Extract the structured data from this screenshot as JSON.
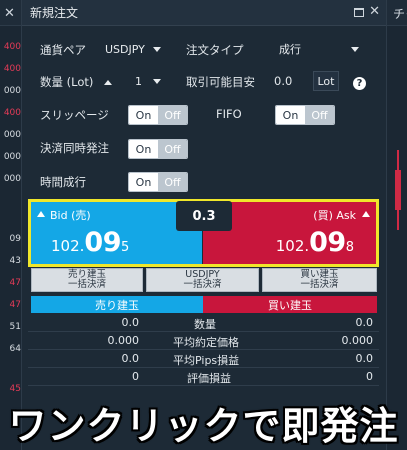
{
  "window": {
    "title": "新規注文"
  },
  "right_panel": {
    "title": "チャ"
  },
  "left_values": [
    "400",
    "400",
    "000",
    "400",
    "000",
    "000",
    "000",
    "09",
    "43",
    "47",
    "47",
    "51",
    "64",
    "45"
  ],
  "form": {
    "currency_pair_label": "通貨ペア",
    "currency_pair_value": "USDJPY",
    "order_type_label": "注文タイプ",
    "order_type_value": "成行",
    "quantity_label": "数量 (Lot)",
    "quantity_value": "1",
    "tradable_label": "取引可能目安",
    "tradable_value": "0.0",
    "tradable_unit": "Lot",
    "help_symbol": "?",
    "slippage_label": "スリッページ",
    "fifo_label": "FIFO",
    "settle_label": "決済同時発注",
    "time_label": "時間成行",
    "on": "On",
    "off": "Off"
  },
  "prices": {
    "bid_label": "Bid (売)",
    "ask_label": "(買) Ask",
    "bid_prefix": "102.",
    "bid_big": "09",
    "bid_suffix": "5",
    "ask_prefix": "102.",
    "ask_big": "09",
    "ask_suffix": "8",
    "spread": "0.3"
  },
  "actions": [
    {
      "line1": "売り建玉",
      "line2": "一括決済"
    },
    {
      "line1": "USDJPY",
      "line2": "一括決済"
    },
    {
      "line1": "買い建玉",
      "line2": "一括決済"
    }
  ],
  "positions": {
    "sell_header": "売り建玉",
    "buy_header": "買い建玉",
    "rows": [
      {
        "label": "数量",
        "sell": "0.0",
        "buy": "0.0"
      },
      {
        "label": "平均約定価格",
        "sell": "0.000",
        "buy": "0.000"
      },
      {
        "label": "平均Pips損益",
        "sell": "0.0",
        "buy": "0.0"
      },
      {
        "label": "評価損益",
        "sell": "0",
        "buy": "0"
      }
    ]
  },
  "caption": "ワンクリックで即発注",
  "colors": {
    "bid": "#14a7e6",
    "ask": "#c8163c",
    "highlight": "#f0e72b",
    "background": "#1d2a36"
  }
}
